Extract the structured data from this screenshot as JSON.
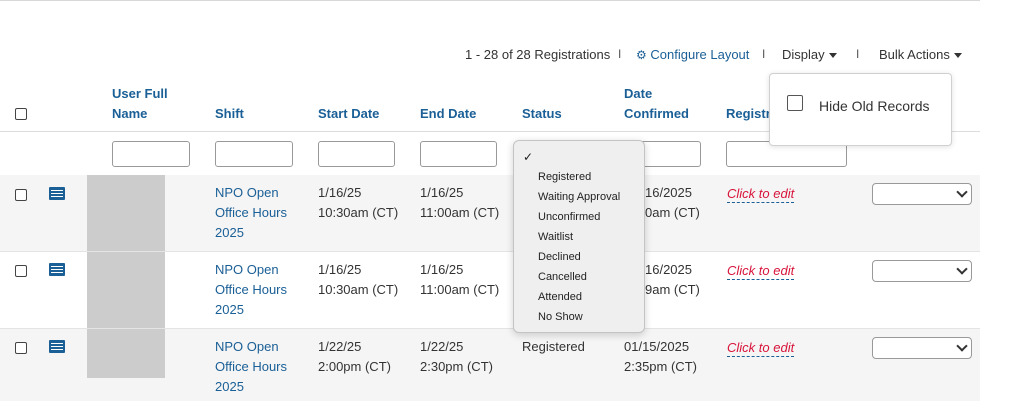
{
  "toolbar": {
    "count_text": "1 - 28 of 28 Registrations",
    "configure_label": "Configure Layout",
    "display_label": "Display",
    "bulk_label": "Bulk Actions",
    "separator": "I"
  },
  "columns": {
    "user_full_name_1": "User Full",
    "user_full_name_2": "Name",
    "shift": "Shift",
    "start_date": "Start Date",
    "end_date": "End Date",
    "status": "Status",
    "date_confirmed_1": "Date",
    "date_confirmed_2": "Confirmed",
    "registration": "Registra"
  },
  "rows": [
    {
      "shift": [
        "NPO Open",
        "Office Hours",
        "2025"
      ],
      "start": [
        "1/16/25",
        "10:30am (CT)"
      ],
      "end": [
        "1/16/25",
        "11:00am (CT)"
      ],
      "status": "",
      "confirmed": [
        "16/2025",
        "0am (CT)"
      ],
      "edit": "Click to edit"
    },
    {
      "shift": [
        "NPO Open",
        "Office Hours",
        "2025"
      ],
      "start": [
        "1/16/25",
        "10:30am (CT)"
      ],
      "end": [
        "1/16/25",
        "11:00am (CT)"
      ],
      "status": "",
      "confirmed": [
        "16/2025",
        "9am (CT)"
      ],
      "edit": "Click to edit"
    },
    {
      "shift": [
        "NPO Open",
        "Office Hours",
        "2025"
      ],
      "start": [
        "1/22/25",
        "2:00pm (CT)"
      ],
      "end": [
        "1/22/25",
        "2:30pm (CT)"
      ],
      "status": "Registered",
      "confirmed": [
        "01/15/2025",
        "2:35pm (CT)"
      ],
      "edit": "Click to edit"
    }
  ],
  "status_dropdown": {
    "checkmark": "✓",
    "options": [
      "Registered",
      "Waiting Approval",
      "Unconfirmed",
      "Waitlist",
      "Declined",
      "Cancelled",
      "Attended",
      "No Show"
    ]
  },
  "display_popover": {
    "hide_old_label": "Hide Old Records"
  },
  "colors": {
    "link": "#1a5f96",
    "edit": "#d8143a"
  }
}
